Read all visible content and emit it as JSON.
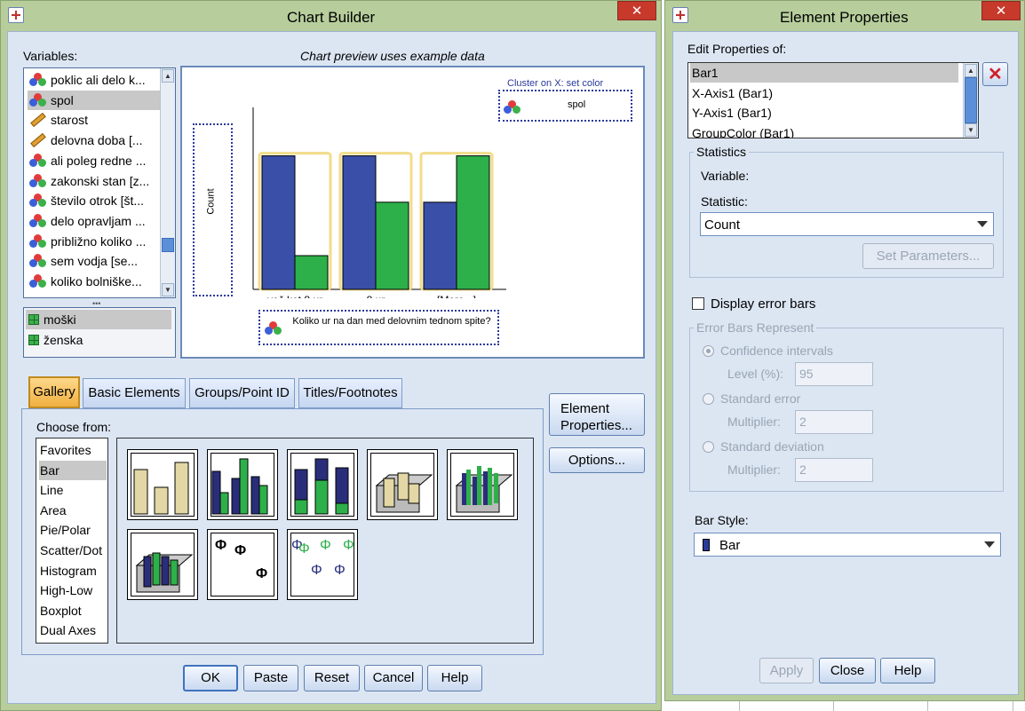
{
  "chart_builder": {
    "title": "Chart Builder",
    "close_label": "✕",
    "variables_label": "Variables:",
    "preview_caption": "Chart preview uses example data",
    "variables": [
      {
        "label": "poklic ali delo k...",
        "icon": "nominal-icon"
      },
      {
        "label": "spol",
        "icon": "nominal-icon"
      },
      {
        "label": "starost",
        "icon": "scale-icon"
      },
      {
        "label": "delovna doba [...",
        "icon": "scale-icon"
      },
      {
        "label": "ali poleg redne ...",
        "icon": "nominal-icon"
      },
      {
        "label": "zakonski stan [z...",
        "icon": "nominal-icon"
      },
      {
        "label": "število otrok [št...",
        "icon": "nominal-icon"
      },
      {
        "label": "delo opravljam ...",
        "icon": "nominal-icon"
      },
      {
        "label": "približno koliko ...",
        "icon": "nominal-icon"
      },
      {
        "label": "sem vodja [se...",
        "icon": "nominal-icon"
      },
      {
        "label": "koliko bolniške...",
        "icon": "nominal-icon"
      }
    ],
    "selected_variable": "spol",
    "categories": [
      "moški",
      "ženska"
    ],
    "cluster_label": "Cluster on X: set color",
    "cluster_variable": "spol",
    "y_axis_label": "Count",
    "x_axis_variable": "Koliko ur na dan med delovnim tednom spite?",
    "tabs": [
      "Gallery",
      "Basic Elements",
      "Groups/Point ID",
      "Titles/Footnotes"
    ],
    "active_tab": "Gallery",
    "choose_from_label": "Choose from:",
    "gallery_types": [
      "Favorites",
      "Bar",
      "Line",
      "Area",
      "Pie/Polar",
      "Scatter/Dot",
      "Histogram",
      "High-Low",
      "Boxplot",
      "Dual Axes"
    ],
    "selected_gallery_type": "Bar",
    "element_properties_button": "Element Properties...",
    "options_button": "Options...",
    "buttons": {
      "ok": "OK",
      "paste": "Paste",
      "reset": "Reset",
      "cancel": "Cancel",
      "help": "Help"
    },
    "colors": {
      "blue": "#3a4fa8",
      "green": "#2db04a",
      "tan": "#e3d7a6"
    }
  },
  "chart_data": {
    "type": "bar",
    "categories": [
      "več kot 8 ur",
      "8 ur",
      "[More...]"
    ],
    "series": [
      {
        "name": "moški",
        "values": [
          9.5,
          9.5,
          6.2
        ]
      },
      {
        "name": "ženska",
        "values": [
          2.4,
          6.2,
          9.5
        ]
      }
    ],
    "ylabel": "Count",
    "xlabel": "Koliko ur na dan med delovnim tednom spite?",
    "ylim": [
      0,
      12
    ],
    "grid": false,
    "legend": "top-right"
  },
  "element_properties": {
    "title": "Element Properties",
    "close_label": "✕",
    "edit_properties_label": "Edit Properties of:",
    "elements": [
      "Bar1",
      "X-Axis1 (Bar1)",
      "Y-Axis1 (Bar1)",
      "GroupColor (Bar1)"
    ],
    "selected_element": "Bar1",
    "delete_icon": "red-x-icon",
    "statistics_title": "Statistics",
    "variable_label": "Variable:",
    "statistic_label": "Statistic:",
    "statistic_value": "Count",
    "set_parameters_button": "Set Parameters...",
    "display_error_bars_label": "Display error bars",
    "error_bars_title": "Error Bars Represent",
    "confidence_intervals_label": "Confidence intervals",
    "level_label": "Level (%):",
    "level_value": "95",
    "standard_error_label": "Standard error",
    "se_multiplier_label": "Multiplier:",
    "se_multiplier_value": "2",
    "standard_deviation_label": "Standard deviation",
    "sd_multiplier_label": "Multiplier:",
    "sd_multiplier_value": "2",
    "bar_style_label": "Bar Style:",
    "bar_style_value": "Bar",
    "buttons": {
      "apply": "Apply",
      "close": "Close",
      "help": "Help"
    }
  }
}
